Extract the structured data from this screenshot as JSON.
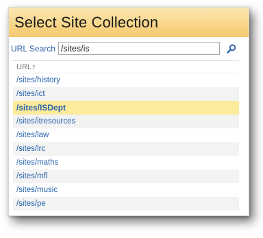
{
  "dialog": {
    "title": "Select Site Collection"
  },
  "search": {
    "label": "URL Search",
    "value": "/sites/is"
  },
  "list": {
    "column_header": "URL",
    "sort_indicator": "↑",
    "items": [
      {
        "label": "/sites/history",
        "selected": false
      },
      {
        "label": "/sites/ict",
        "selected": false
      },
      {
        "label": "/sites/ISDept",
        "selected": true
      },
      {
        "label": "/sites/itresources",
        "selected": false
      },
      {
        "label": "/sites/law",
        "selected": false
      },
      {
        "label": "/sites/lrc",
        "selected": false
      },
      {
        "label": "/sites/maths",
        "selected": false
      },
      {
        "label": "/sites/mfl",
        "selected": false
      },
      {
        "label": "/sites/music",
        "selected": false
      },
      {
        "label": "/sites/pe",
        "selected": false
      }
    ]
  },
  "colors": {
    "title_gradient_top": "#fbe7b4",
    "title_gradient_bottom": "#f5c96e",
    "link": "#2462ad",
    "selected_row": "#fbeb9a"
  },
  "icons": {
    "search_button": "search-icon"
  }
}
